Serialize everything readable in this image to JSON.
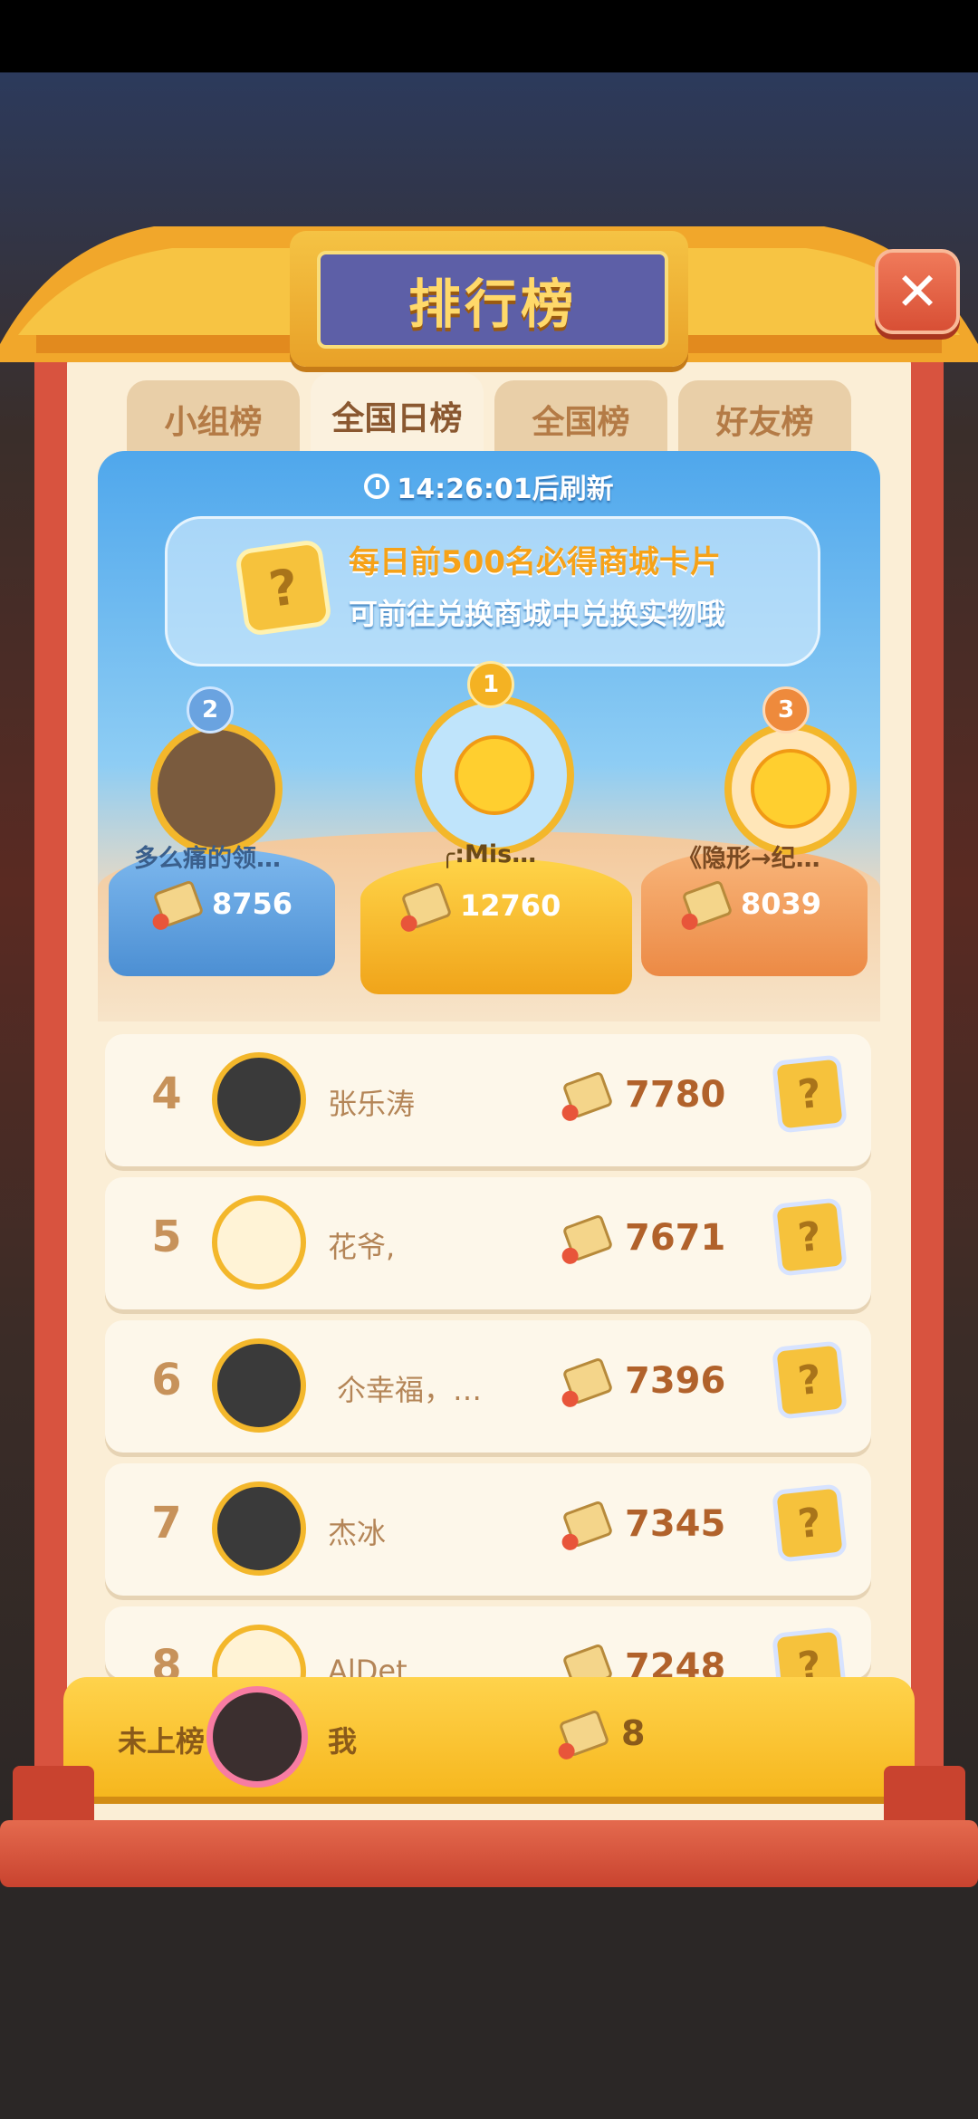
{
  "title": "排行榜",
  "tabs": [
    {
      "label": "小组榜",
      "active": false
    },
    {
      "label": "全国日榜",
      "active": true
    },
    {
      "label": "全国榜",
      "active": false
    },
    {
      "label": "好友榜",
      "active": false
    }
  ],
  "timer": {
    "text": "14:26:01后刷新"
  },
  "banner": {
    "line1": "每日前500名必得商城卡片",
    "line2": "可前往兑换商城中兑换实物哦",
    "card_glyph": "?"
  },
  "podium": {
    "second": {
      "rank": "2",
      "name": "多么痛的领…",
      "score": "8756"
    },
    "first": {
      "rank": "1",
      "name": "╭:Mis…",
      "score": "12760"
    },
    "third": {
      "rank": "3",
      "name": "《隐形→纪…",
      "score": "8039"
    }
  },
  "rows": [
    {
      "rank": "4",
      "name": "张乐涛",
      "score": "7780",
      "card": "?"
    },
    {
      "rank": "5",
      "name": "花爷,",
      "score": "7671",
      "card": "?"
    },
    {
      "rank": "6",
      "name": "尒幸福，…",
      "score": "7396",
      "card": "?"
    },
    {
      "rank": "7",
      "name": "杰冰",
      "score": "7345",
      "card": "?"
    },
    {
      "rank": "8",
      "name": "AlDet",
      "score": "7248",
      "card": "?"
    }
  ],
  "me": {
    "rank_text": "未上榜",
    "name": "我",
    "score": "8"
  },
  "colors": {
    "accent": "#f6b71e",
    "panel": "#d8533f",
    "hero_sky": "#4fa7ec"
  },
  "icons": [
    "close-icon",
    "clock-icon",
    "lamp-icon",
    "card-icon"
  ]
}
